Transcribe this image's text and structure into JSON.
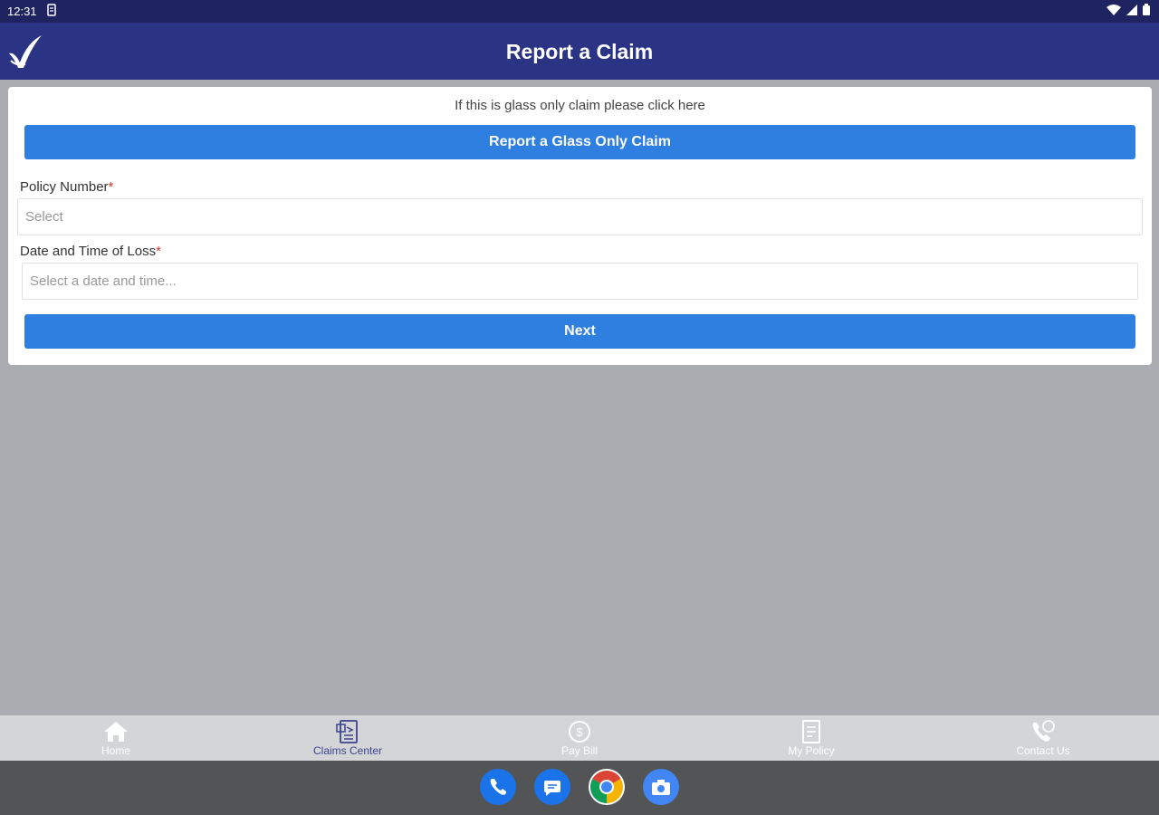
{
  "status_bar": {
    "time": "12:31"
  },
  "app_bar": {
    "title": "Report a Claim"
  },
  "form": {
    "glass_prompt": "If this is glass only claim please click here",
    "glass_button_label": "Report a Glass Only Claim",
    "policy_label": "Policy Number",
    "policy_placeholder": "Select",
    "date_label": "Date and Time of Loss",
    "date_placeholder": "Select a date and time...",
    "required_marker": "*",
    "next_label": "Next"
  },
  "bottom_nav": {
    "items": [
      {
        "label": "Home",
        "icon": "home-icon"
      },
      {
        "label": "Claims Center",
        "icon": "claims-icon",
        "active": true
      },
      {
        "label": "Pay Bill",
        "icon": "dollar-icon"
      },
      {
        "label": "My Policy",
        "icon": "policy-icon"
      },
      {
        "label": "Contact Us",
        "icon": "phone-icon"
      }
    ]
  },
  "colors": {
    "header": "#2b3384",
    "status_bar": "#1f2460",
    "button": "#2e7fe0",
    "required": "#d9342b",
    "nav_active": "#3b4390"
  }
}
